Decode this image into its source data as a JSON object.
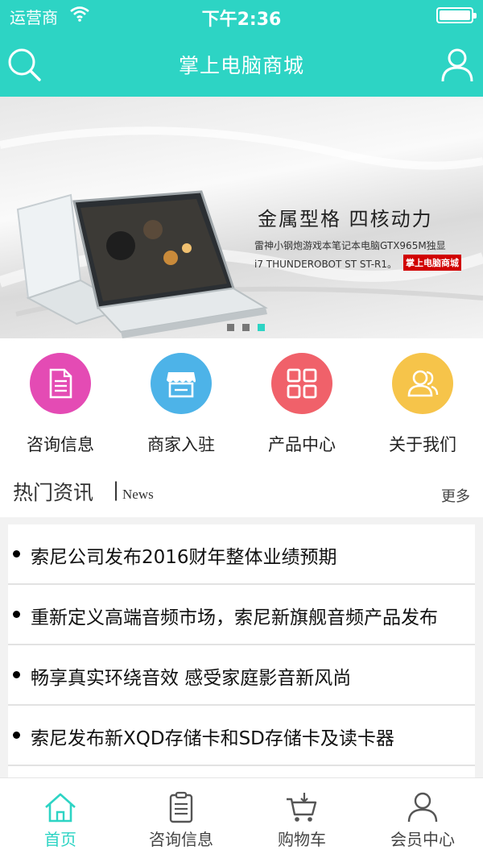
{
  "status_bar": {
    "carrier": "运营商",
    "time": "下午2:36"
  },
  "nav": {
    "title": "掌上电脑商城",
    "search_icon": "search-icon",
    "user_icon": "user-icon"
  },
  "banner": {
    "headline": "金属型格  四核动力",
    "subline1": "雷神小钢炮游戏本笔记本电脑GTX965M独显",
    "subline2": "i7 THUNDEROBOT ST ST-R1。",
    "badge": "掌上电脑商城",
    "slide_count": 3,
    "active_slide": 3
  },
  "categories": [
    {
      "label": "咨询信息",
      "icon": "document-icon",
      "color": "#e44bb4"
    },
    {
      "label": "商家入驻",
      "icon": "storefront-icon",
      "color": "#4db3e8"
    },
    {
      "label": "产品中心",
      "icon": "grid-icon",
      "color": "#f0616a"
    },
    {
      "label": "关于我们",
      "icon": "people-icon",
      "color": "#f6c44a"
    }
  ],
  "news": {
    "title": "热门资讯",
    "separator": "|",
    "title_en": "News",
    "more": "更多",
    "items": [
      "索尼公司发布2016财年整体业绩预期",
      "重新定义高端音频市场，索尼新旗舰音频产品发布",
      "畅享真实环绕音效 感受家庭影音新风尚",
      "索尼发布新XQD存储卡和SD存储卡及读卡器"
    ]
  },
  "tabbar": {
    "items": [
      {
        "label": "首页",
        "icon": "home-icon",
        "active": true
      },
      {
        "label": "咨询信息",
        "icon": "clipboard-icon",
        "active": false
      },
      {
        "label": "购物车",
        "icon": "cart-icon",
        "active": false
      },
      {
        "label": "会员中心",
        "icon": "member-icon",
        "active": false
      }
    ]
  },
  "colors": {
    "accent": "#2dd4c4",
    "banner_badge": "#d10000"
  }
}
